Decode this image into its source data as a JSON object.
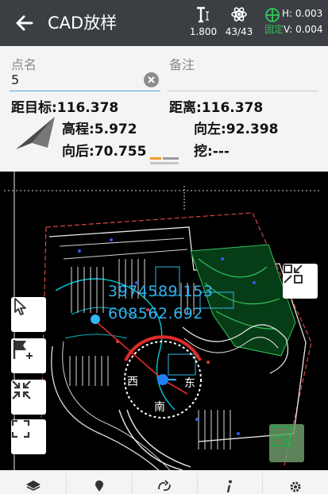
{
  "header": {
    "title": "CAD放样",
    "antenna_height": "1.800",
    "satellites": "43/43",
    "h_precision": "H: 0.003",
    "fix_label": "固定",
    "v_precision": "V: 0.004",
    "fix_color": "#2fc05a"
  },
  "form": {
    "point_name_label": "点名",
    "point_name_value": "5",
    "remark_label": "备注",
    "remark_value": ""
  },
  "readings": {
    "dist_target": "距目标:116.378",
    "distance": "距离:116.378",
    "elevation": "高程:5.972",
    "to_left": "向左:92.398",
    "backward": "向后:70.755",
    "cut": "挖:---"
  },
  "map": {
    "coord_x": "3974589.153",
    "coord_y": "608562.692",
    "label_west": "西",
    "label_east": "东",
    "label_south": "南",
    "coord_color": "#31b4f2"
  },
  "icons": {
    "header": [
      "back-arrow-icon",
      "antenna-pole-icon",
      "satellite-icon",
      "gps-target-icon"
    ],
    "map_tools": [
      "select-pointer-icon",
      "flag-add-icon",
      "zoom-fit-icon",
      "fullscreen-icon",
      "zoom-window-icon",
      "locate-map-icon"
    ],
    "bottom": [
      "layers-icon",
      "pin-icon",
      "sync-icon",
      "info-icon",
      "settings-icon"
    ]
  }
}
